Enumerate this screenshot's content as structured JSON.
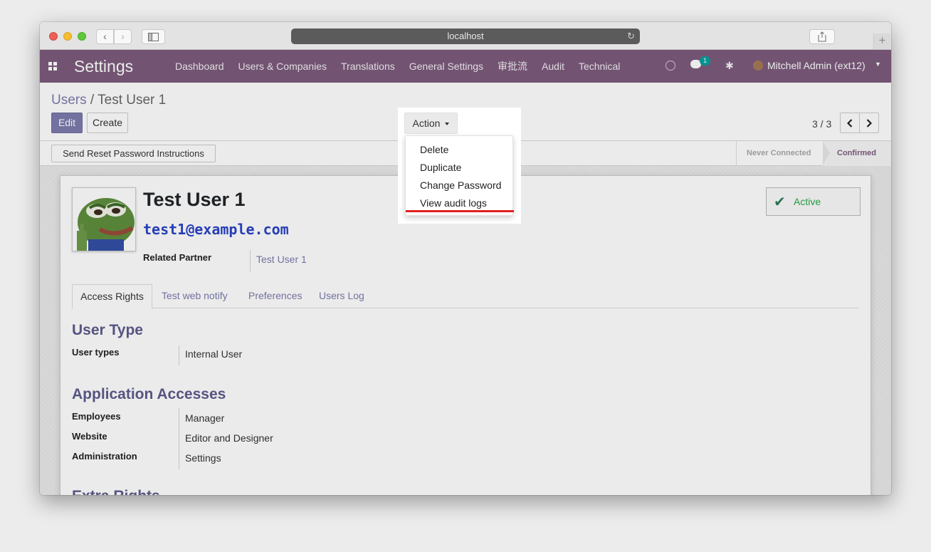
{
  "browser": {
    "url": "localhost"
  },
  "navbar": {
    "brand": "Settings",
    "menu": [
      "Dashboard",
      "Users & Companies",
      "Translations",
      "General Settings",
      "审批流",
      "Audit",
      "Technical"
    ],
    "chat_count": "1",
    "user": "Mitchell Admin (ext12)",
    "accent_color": "#7c5c7c"
  },
  "control_panel": {
    "breadcrumb_parent": "Users",
    "breadcrumb_separator": "/",
    "breadcrumb_current": "Test User 1",
    "edit_label": "Edit",
    "create_label": "Create",
    "action_label": "Action",
    "pager": "3 / 3"
  },
  "action_menu": {
    "items": [
      "Delete",
      "Duplicate",
      "Change Password",
      "View audit logs"
    ]
  },
  "statusbar": {
    "reset_button": "Send Reset Password Instructions",
    "stages": [
      "Never Connected",
      "Confirmed"
    ],
    "current_stage": "Confirmed"
  },
  "form": {
    "name": "Test User 1",
    "email": "test1@example.com",
    "related_partner_label": "Related Partner",
    "related_partner_value": "Test User 1",
    "active_label": "Active",
    "tabs": [
      "Access Rights",
      "Test web notify",
      "Preferences",
      "Users Log"
    ],
    "active_tab": "Access Rights",
    "user_type_section": "User Type",
    "user_types_label": "User types",
    "user_types_value": "Internal User",
    "app_access_section": "Application Accesses",
    "app_access": [
      {
        "label": "Employees",
        "value": "Manager"
      },
      {
        "label": "Website",
        "value": "Editor and Designer"
      },
      {
        "label": "Administration",
        "value": "Settings"
      }
    ],
    "extra_rights_section": "Extra Rights"
  }
}
